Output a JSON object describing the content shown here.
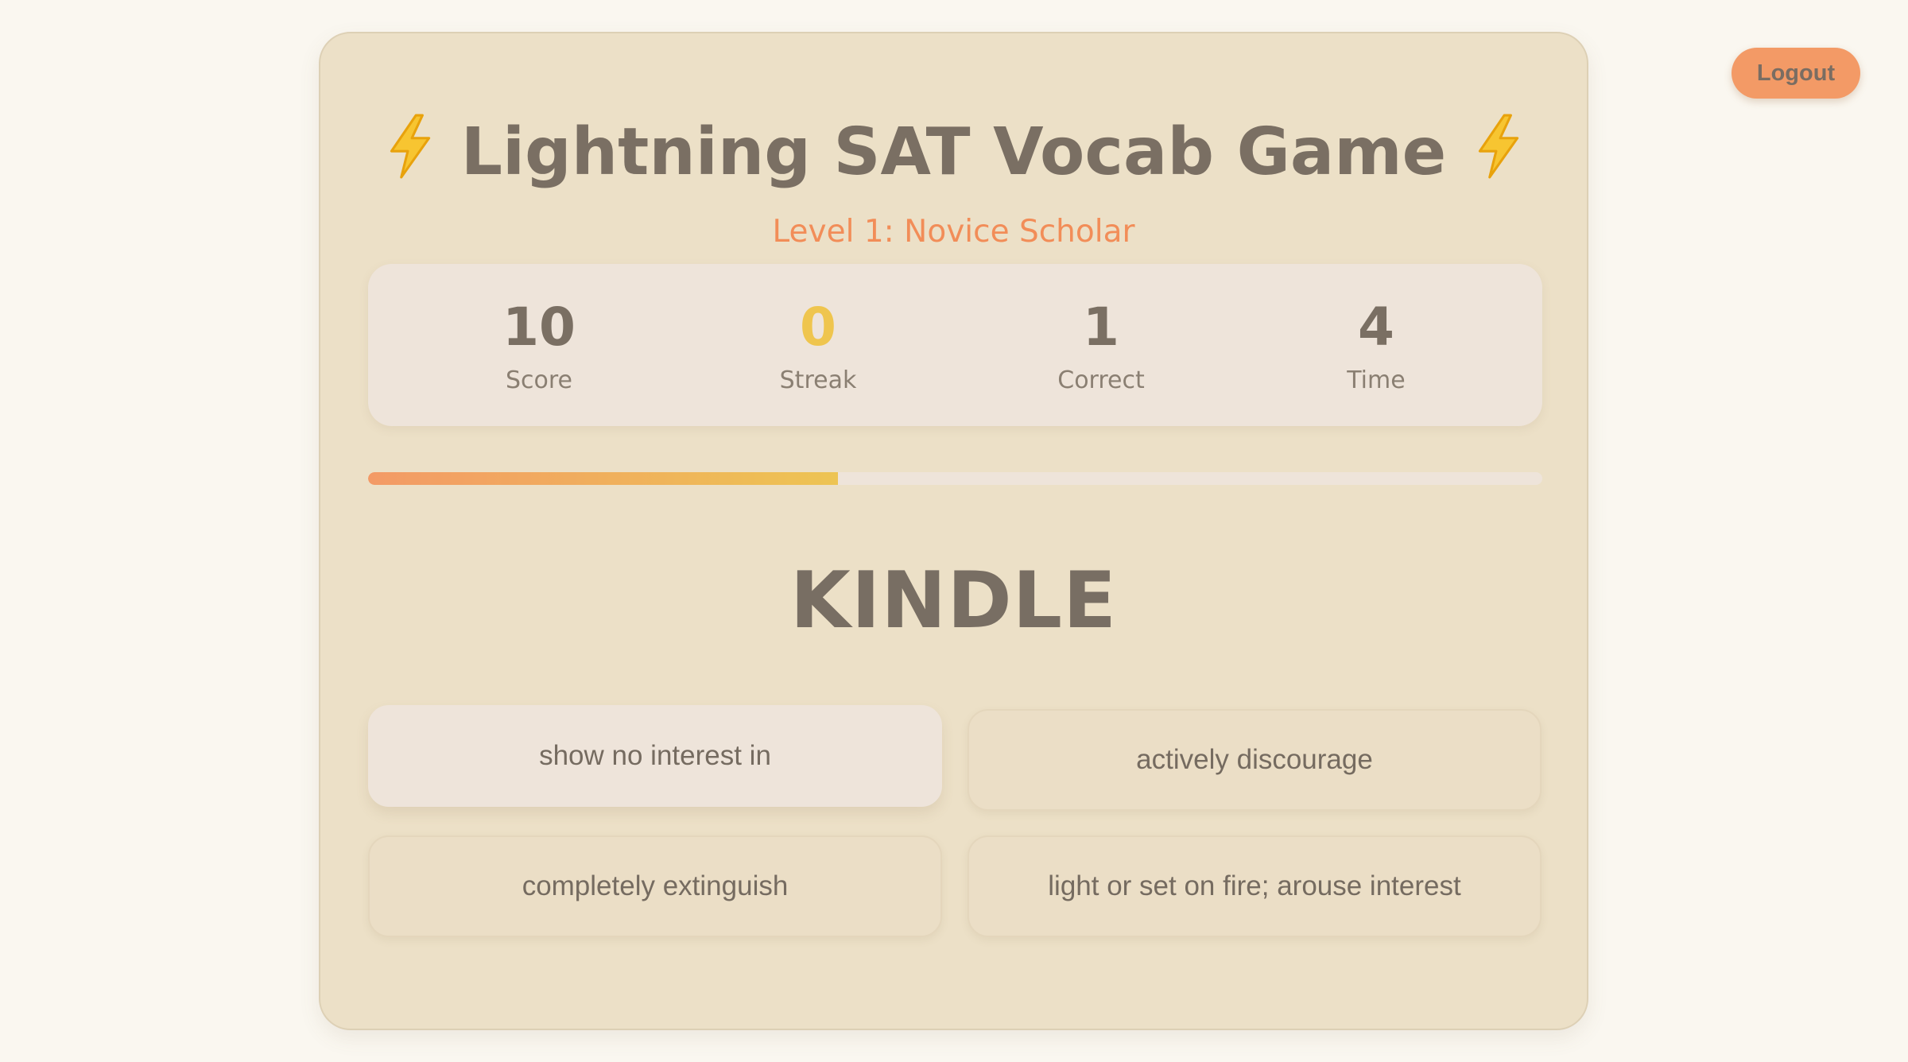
{
  "header": {
    "logout_label": "Logout"
  },
  "game": {
    "title": "Lightning SAT Vocab Game",
    "title_icon": "lightning-bolt-icon",
    "level": "Level 1: Novice Scholar",
    "stats": [
      {
        "value": "10",
        "label": "Score"
      },
      {
        "value": "0",
        "label": "Streak"
      },
      {
        "value": "1",
        "label": "Correct"
      },
      {
        "value": "4",
        "label": "Time"
      }
    ],
    "progress_fraction": 0.4,
    "word": "KINDLE",
    "options": [
      "show no interest in",
      "actively discourage",
      "completely extinguish",
      "light or set on fire; arouse interest"
    ]
  },
  "colors": {
    "background": "#faf7f0",
    "card": "#ece0c7",
    "accent_orange": "#f39a66",
    "accent_yellow": "#efc54e",
    "text": "#7a6f63"
  }
}
